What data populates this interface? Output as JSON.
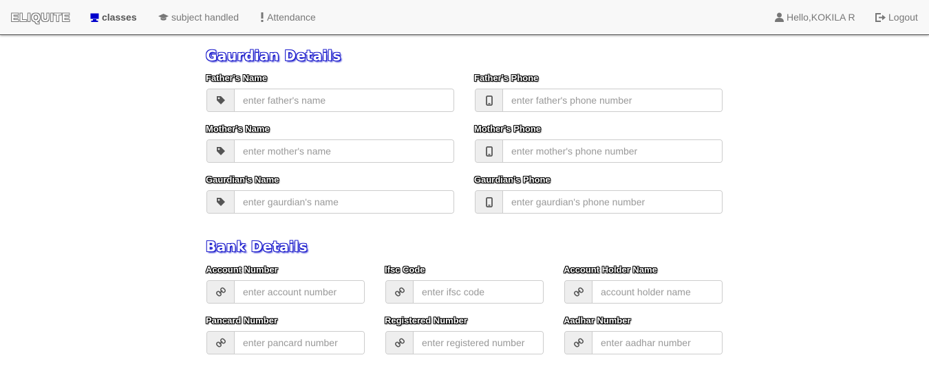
{
  "navbar": {
    "brand": "ELIQUITE",
    "classes": "classes",
    "subject_handled": "subject handled",
    "attendance": "Attendance",
    "user": "Hello,KOKILA R",
    "logout": "Logout"
  },
  "guardian": {
    "title": "Gaurdian Details",
    "father_name_label": "Father's Name",
    "father_name_placeholder": "enter father's name",
    "father_phone_label": "Father's Phone",
    "father_phone_placeholder": "enter father's phone number",
    "mother_name_label": "Mother's Name",
    "mother_name_placeholder": "enter mother's name",
    "mother_phone_label": "Mother's Phone",
    "mother_phone_placeholder": "enter mother's phone number",
    "guardian_name_label": "Gaurdian's Name",
    "guardian_name_placeholder": "enter gaurdian's name",
    "guardian_phone_label": "Gaurdian's Phone",
    "guardian_phone_placeholder": "enter gaurdian's phone number"
  },
  "bank": {
    "title": "Bank Details",
    "account_number_label": "Account Number",
    "account_number_placeholder": "enter account number",
    "ifsc_label": "Ifsc Code",
    "ifsc_placeholder": "enter ifsc code",
    "holder_label": "Account Holder Name",
    "holder_placeholder": "account holder name",
    "pancard_label": "Pancard Number",
    "pancard_placeholder": "enter pancard number",
    "registered_label": "Registered Number",
    "registered_placeholder": "enter registered number",
    "aadhar_label": "Aadhar Number",
    "aadhar_placeholder": "enter aadhar number"
  },
  "icons": {
    "classes": "monitor-icon",
    "subject_handled": "graduation-cap-icon",
    "attendance": "exclamation-icon",
    "user": "user-icon",
    "logout": "logout-icon",
    "name_field": "tag-icon",
    "phone_field": "phone-icon",
    "bank_field": "link-icon"
  },
  "colors": {
    "section_title": "#1a1acc",
    "classes_icon": "#0000cc"
  }
}
